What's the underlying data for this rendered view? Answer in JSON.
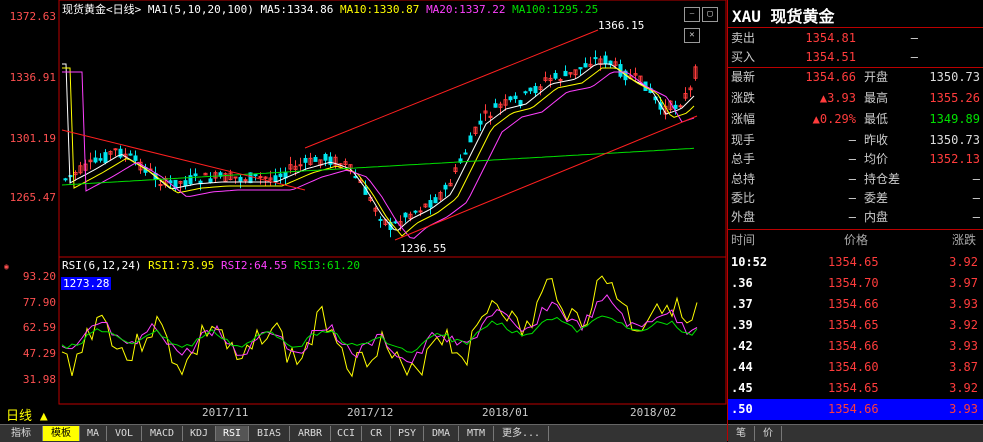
{
  "header": {
    "title": "现货黄金<日线>",
    "ma_label": "MA1(5,10,20,100)",
    "ma5": "MA5:1334.86",
    "ma10": "MA10:1330.87",
    "ma20": "MA20:1337.22",
    "ma100": "MA100:1295.25"
  },
  "y_axis": [
    "1372.63",
    "1336.91",
    "1301.19",
    "1265.47"
  ],
  "annotations": {
    "high": "1366.15",
    "low": "1236.55"
  },
  "rsi": {
    "label": "RSI(6,12,24)",
    "rsi1": "RSI1:73.95",
    "rsi2": "RSI2:64.55",
    "rsi3": "RSI3:61.20",
    "cursor_value": "1273.28",
    "ticks": [
      "93.20",
      "77.90",
      "62.59",
      "47.29",
      "31.98"
    ]
  },
  "x_labels": [
    "2017/11",
    "2017/12",
    "2018/01",
    "2018/02"
  ],
  "period_label": "日线",
  "tabs": [
    "指标",
    "模板",
    "MA",
    "VOL",
    "MACD",
    "KDJ",
    "RSI",
    "BIAS",
    "ARBR",
    "CCI",
    "CR",
    "PSY",
    "DMA",
    "MTM",
    "更多..."
  ],
  "quote": {
    "title": "XAU 现货黄金",
    "sell_label": "卖出",
    "sell": "1354.81",
    "sell_vol": "—",
    "buy_label": "买入",
    "buy": "1354.51",
    "buy_vol": "—",
    "last_label": "最新",
    "last": "1354.66",
    "open_label": "开盘",
    "open": "1350.73",
    "change_label": "涨跌",
    "change": "▲3.93",
    "high_label": "最高",
    "high": "1355.26",
    "pct_label": "涨幅",
    "pct": "▲0.29%",
    "low_label": "最低",
    "low": "1349.89",
    "now_hand_label": "现手",
    "now_hand": "—",
    "prev_close_label": "昨收",
    "prev_close": "1350.73",
    "total_hand_label": "总手",
    "total_hand": "—",
    "avg_label": "均价",
    "avg": "1352.13",
    "total_hold_label": "总持",
    "total_hold": "—",
    "hold_diff_label": "持仓差",
    "hold_diff": "—",
    "ratio_label": "委比",
    "ratio": "—",
    "diff_label": "委差",
    "diff": "—",
    "outer_label": "外盘",
    "outer": "—",
    "inner_label": "内盘",
    "inner": "—"
  },
  "ticks_table": {
    "headers": [
      "时间",
      "价格",
      "涨跌"
    ],
    "rows": [
      {
        "time": "10:52",
        "price": "1354.65",
        "change": "3.92"
      },
      {
        "time": ".36",
        "price": "1354.70",
        "change": "3.97"
      },
      {
        "time": ".37",
        "price": "1354.66",
        "change": "3.93"
      },
      {
        "time": ".39",
        "price": "1354.65",
        "change": "3.92"
      },
      {
        "time": ".42",
        "price": "1354.66",
        "change": "3.93"
      },
      {
        "time": ".44",
        "price": "1354.60",
        "change": "3.87"
      },
      {
        "time": ".45",
        "price": "1354.65",
        "change": "3.92"
      },
      {
        "time": ".50",
        "price": "1354.66",
        "change": "3.93"
      }
    ]
  },
  "bottom_tabs": [
    "笔",
    "价"
  ]
}
